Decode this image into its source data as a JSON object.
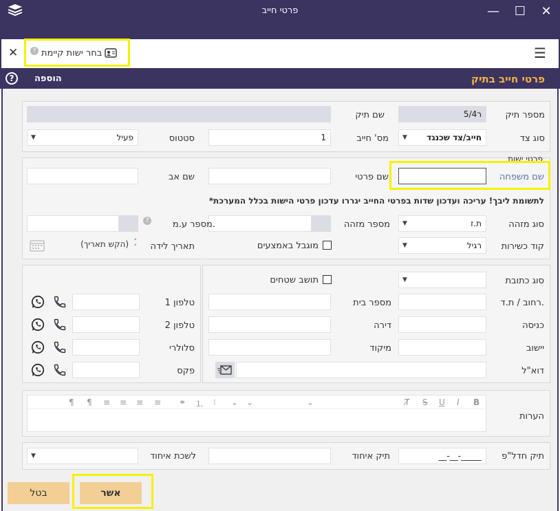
{
  "window": {
    "title": "פרטי חייב",
    "minimize": "—",
    "maximize": "☐",
    "close": "✕"
  },
  "toolbar": {
    "select_entity": "בחר ישות קיימת",
    "close": "✕",
    "menu": "☰"
  },
  "header": {
    "title": "פרטי חייב בתיק",
    "add": "הוספה",
    "help": "?"
  },
  "case": {
    "case_number_label": "מספר תיק",
    "case_number_value": "5/4ר",
    "case_name_label": "שם תיק",
    "case_name_value": "",
    "side_type_label": "סוג צד",
    "side_type_value": "חייב/צד שכנגד",
    "debtor_no_label": "מס' חייב",
    "debtor_no_value": "1",
    "status_label": "סטטוס",
    "status_value": "פעיל"
  },
  "entity": {
    "legend": "פרטי ישות",
    "last_name_label": "שם משפחה",
    "first_name_label": "שם פרטי",
    "father_name_label": "שם אב",
    "notice": "*לתשומת ליבך! עריכה ועדכון שדות בפרטי החייב יגררו עדכון פרטי הישות בכלל המערכת",
    "id_type_label": "סוג מזהה",
    "id_type_value": "ת.ז",
    "id_number_label": "מספר מזהה",
    "vat_number_label": "מספר ע.מ.",
    "kashrut_label": "קוד כשירות",
    "kashrut_value": "רגיל",
    "limited_label": "מוגבל באמצעים",
    "birth_date_label": "תאריך לידה",
    "birth_date_placeholder": "(הקש תאריך)"
  },
  "address": {
    "address_type_label": "סוג כתובת",
    "territories_label": "תושב שטחים",
    "street_label": "רחוב / ת.ד.",
    "house_label": "מספר בית",
    "entrance_label": "כניסה",
    "apartment_label": "דירה",
    "city_label": "יישוב",
    "zip_label": "מיקוד",
    "email_label": "דוא\"ל"
  },
  "phones": {
    "phone1_label": "טלפון 1",
    "phone2_label": "טלפון 2",
    "cell_label": "סלולרי",
    "fax_label": "פקס"
  },
  "notes": {
    "label": "הערות"
  },
  "bankruptcy": {
    "case_label": "תיק חדל\"פ",
    "case_value": "__-__-_____",
    "merge_label": "תיק איחוד",
    "send_label": "לשכת איחוד"
  },
  "buttons": {
    "confirm": "אשר",
    "cancel": "בטל"
  },
  "colors": {
    "titlebar": "#3b3360",
    "header_title": "#f2b443",
    "highlight": "#f7f000",
    "button": "#f3cf95"
  }
}
